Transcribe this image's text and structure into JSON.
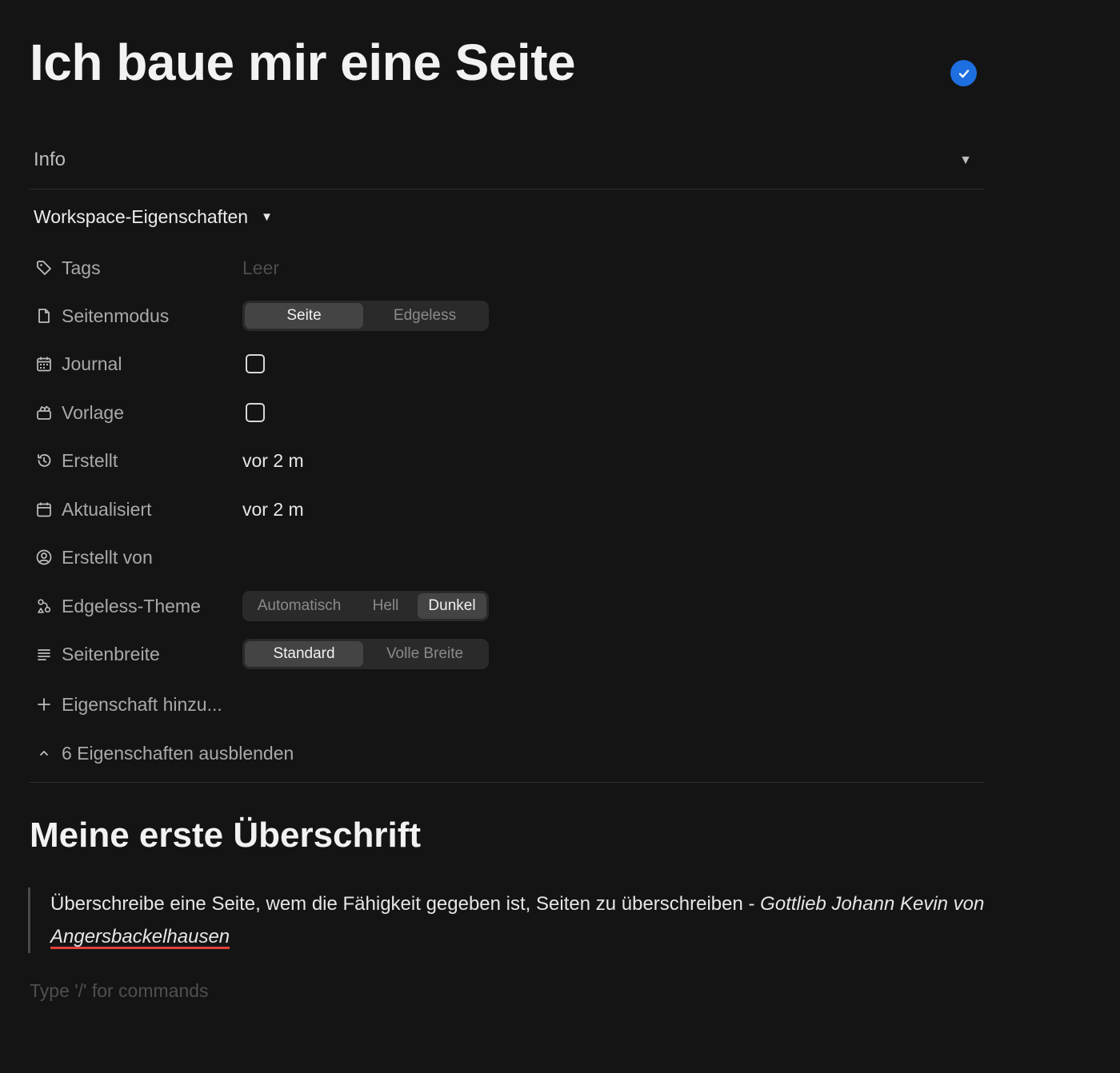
{
  "page": {
    "title": "Ich baue mir eine Seite",
    "sync_status_icon": "check-circle-icon",
    "accent_color": "#1e6fe0"
  },
  "info": {
    "label": "Info",
    "caret": "▼"
  },
  "workspace": {
    "title": "Workspace-Eigenschaften",
    "caret": "▼"
  },
  "properties": {
    "tags": {
      "label": "Tags",
      "value": "Leer",
      "icon": "tag-icon"
    },
    "seitenmodus": {
      "label": "Seitenmodus",
      "icon": "page-icon",
      "options": [
        "Seite",
        "Edgeless"
      ],
      "selected": "Seite"
    },
    "journal": {
      "label": "Journal",
      "icon": "calendar-grid-icon",
      "checked": false
    },
    "vorlage": {
      "label": "Vorlage",
      "icon": "template-icon",
      "checked": false
    },
    "erstellt": {
      "label": "Erstellt",
      "value": "vor 2 m",
      "icon": "history-icon"
    },
    "aktualisiert": {
      "label": "Aktualisiert",
      "value": "vor 2 m",
      "icon": "calendar-icon"
    },
    "erstellt_von": {
      "label": "Erstellt von",
      "icon": "user-circle-icon"
    },
    "edgeless_theme": {
      "label": "Edgeless-Theme",
      "icon": "theme-icon",
      "options": [
        "Automatisch",
        "Hell",
        "Dunkel"
      ],
      "selected": "Dunkel"
    },
    "seitenbreite": {
      "label": "Seitenbreite",
      "icon": "lines-icon",
      "options": [
        "Standard",
        "Volle Breite"
      ],
      "selected": "Standard"
    }
  },
  "actions": {
    "add_property": "Eigenschaft hinzu...",
    "hide_properties": "6 Eigenschaften ausblenden"
  },
  "content": {
    "heading": "Meine erste Überschrift",
    "quote_text": "Überschreibe eine Seite, wem die Fähigkeit gegeben ist, Seiten zu überschreiben - ",
    "quote_author_part1": "Gottlieb Johann Kevin von ",
    "quote_author_part2": "Angersbackelhausen",
    "command_placeholder": "Type '/' for commands"
  }
}
